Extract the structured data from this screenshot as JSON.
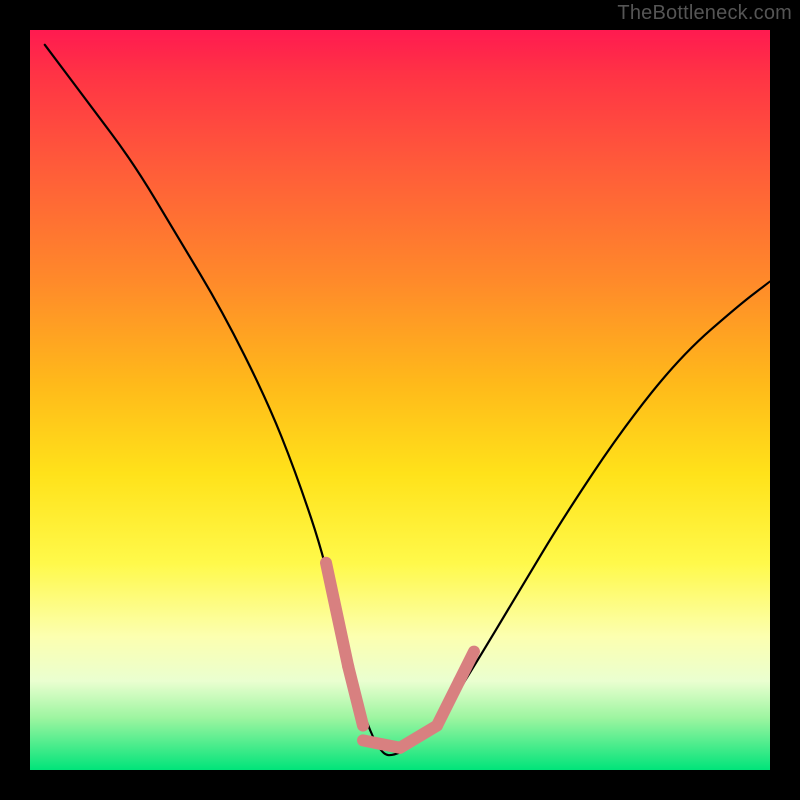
{
  "watermark": "TheBottleneck.com",
  "chart_data": {
    "type": "line",
    "title": "",
    "xlabel": "",
    "ylabel": "",
    "xlim": [
      0,
      100
    ],
    "ylim": [
      0,
      100
    ],
    "grid": false,
    "series": [
      {
        "name": "curve",
        "x": [
          2,
          8,
          14,
          20,
          26,
          32,
          36,
          40,
          43,
          47,
          50,
          55,
          60,
          66,
          72,
          80,
          88,
          96,
          100
        ],
        "values": [
          98,
          90,
          82,
          72,
          62,
          50,
          40,
          28,
          14,
          2,
          2,
          6,
          14,
          24,
          34,
          46,
          56,
          63,
          66
        ]
      }
    ],
    "gradient_stops": [
      {
        "pos": 0,
        "color": "#ff1a50"
      },
      {
        "pos": 6,
        "color": "#ff3345"
      },
      {
        "pos": 18,
        "color": "#ff5a3a"
      },
      {
        "pos": 34,
        "color": "#ff8a2a"
      },
      {
        "pos": 48,
        "color": "#ffba1a"
      },
      {
        "pos": 60,
        "color": "#ffe21a"
      },
      {
        "pos": 72,
        "color": "#fff94a"
      },
      {
        "pos": 82,
        "color": "#fcffb0"
      },
      {
        "pos": 88,
        "color": "#eaffd0"
      },
      {
        "pos": 93,
        "color": "#9cf5a0"
      },
      {
        "pos": 100,
        "color": "#00e47a"
      }
    ],
    "highlight": {
      "color": "#d88080",
      "segments": [
        {
          "x1": 40,
          "y1": 28,
          "x2": 43,
          "y2": 14
        },
        {
          "x1": 43,
          "y1": 14,
          "x2": 45,
          "y2": 6
        },
        {
          "x1": 45,
          "y1": 4,
          "x2": 50,
          "y2": 3
        },
        {
          "x1": 50,
          "y1": 3,
          "x2": 55,
          "y2": 6
        },
        {
          "x1": 55,
          "y1": 6,
          "x2": 58,
          "y2": 12
        },
        {
          "x1": 58,
          "y1": 12,
          "x2": 60,
          "y2": 16
        }
      ]
    }
  }
}
